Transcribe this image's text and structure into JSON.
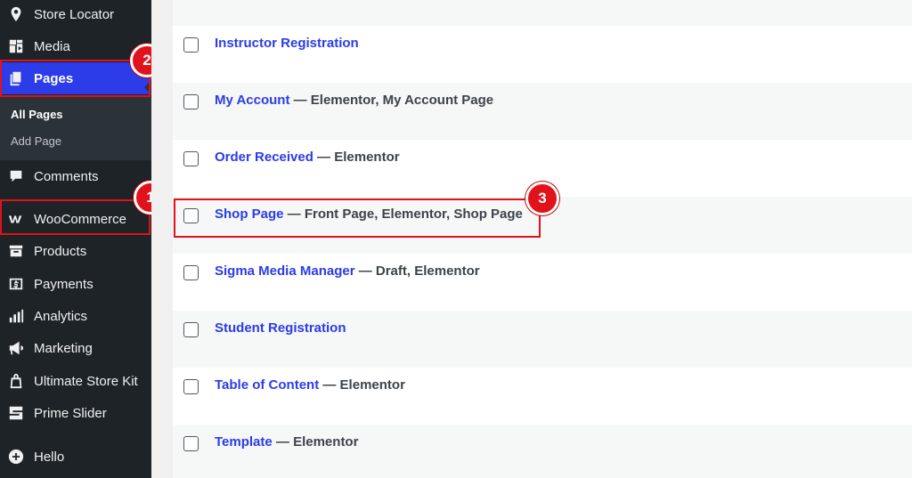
{
  "sidebar": {
    "items": [
      {
        "label": "Store Locator",
        "icon": "map-pin-icon"
      },
      {
        "label": "Media",
        "icon": "media-icon"
      },
      {
        "label": "Pages",
        "icon": "pages-icon"
      },
      {
        "label": "Comments",
        "icon": "comment-icon"
      },
      {
        "label": "WooCommerce",
        "icon": "woocommerce-icon"
      },
      {
        "label": "Products",
        "icon": "archive-icon"
      },
      {
        "label": "Payments",
        "icon": "payments-icon"
      },
      {
        "label": "Analytics",
        "icon": "analytics-icon"
      },
      {
        "label": "Marketing",
        "icon": "megaphone-icon"
      },
      {
        "label": "Ultimate Store Kit",
        "icon": "bag-icon"
      },
      {
        "label": "Prime Slider",
        "icon": "slider-icon"
      },
      {
        "label": "Hello",
        "icon": "plus-circle-icon"
      }
    ],
    "submenu": [
      {
        "label": "All Pages"
      },
      {
        "label": "Add Page"
      }
    ]
  },
  "badges": {
    "one": "1",
    "two": "2",
    "three": "3"
  },
  "pages_list": {
    "rows": [
      {
        "title": "Instructor Registration",
        "states": ""
      },
      {
        "title": "My Account",
        "states": " — Elementor, My Account Page"
      },
      {
        "title": "Order Received",
        "states": " — Elementor"
      },
      {
        "title": "Shop Page",
        "states": " — Front Page, Elementor, Shop Page"
      },
      {
        "title": "Sigma Media Manager",
        "states": " — Draft, Elementor"
      },
      {
        "title": "Student Registration",
        "states": ""
      },
      {
        "title": "Table of Content",
        "states": " — Elementor"
      },
      {
        "title": "Template",
        "states": " — Elementor"
      }
    ]
  },
  "colors": {
    "accent": "#2b3ce8",
    "highlight": "#e0121c",
    "sidebar_bg": "#1d2327"
  }
}
